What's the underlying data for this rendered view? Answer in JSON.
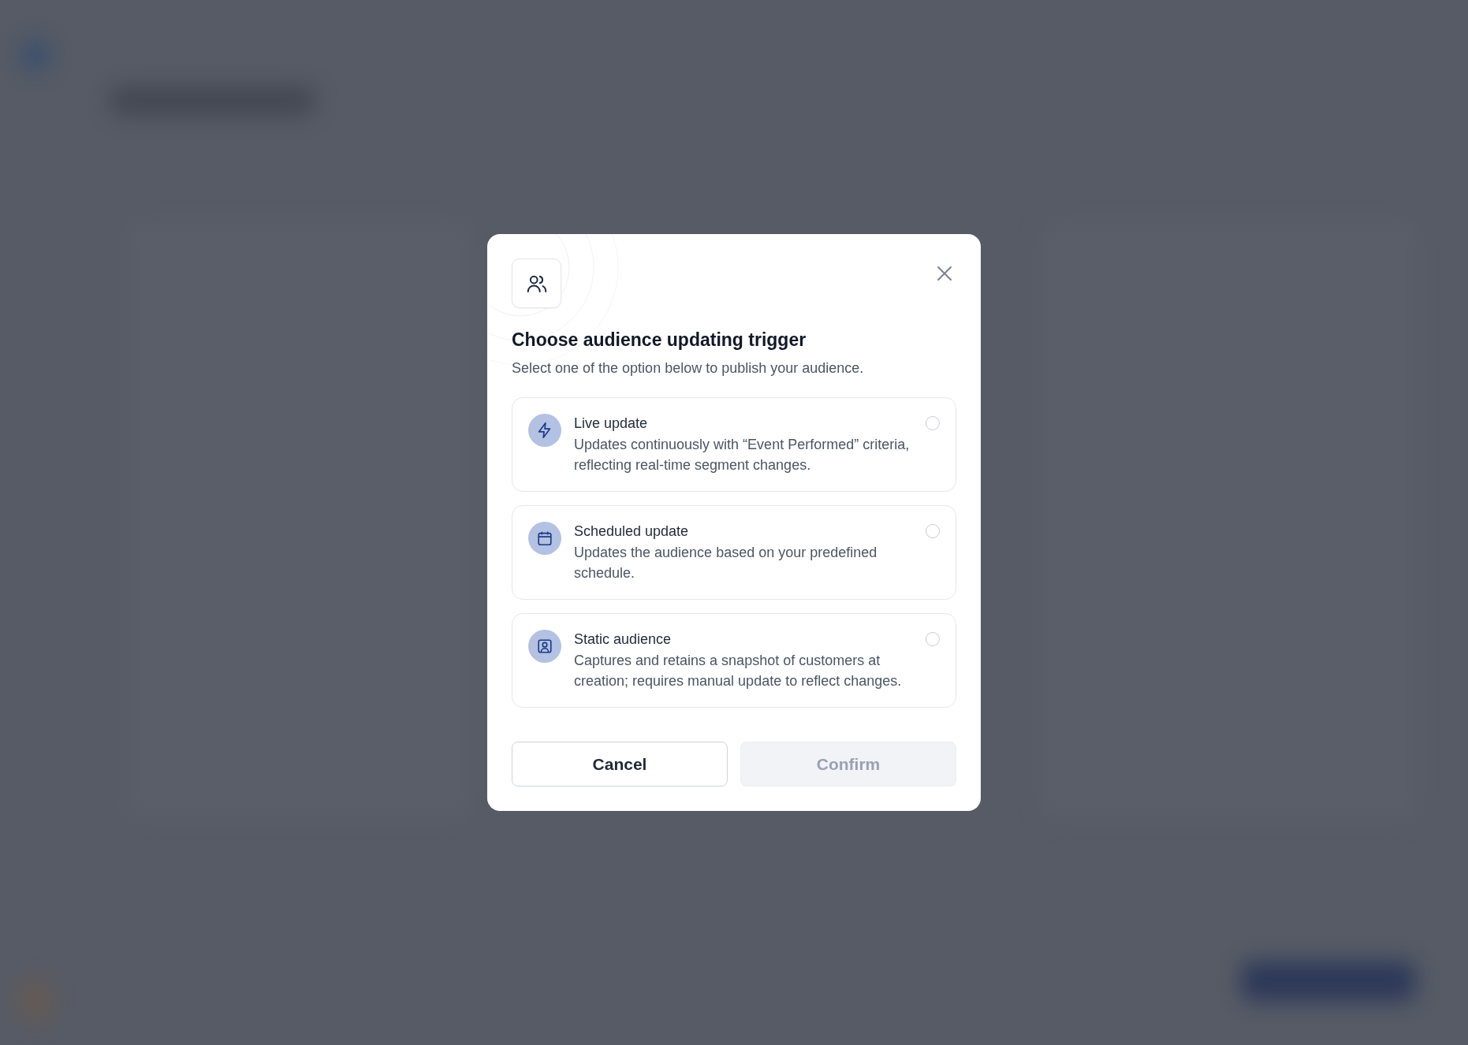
{
  "dialog": {
    "title": "Choose audience updating trigger",
    "subtitle": "Select one of the option below to publish your audience."
  },
  "options": [
    {
      "kind": "lightning",
      "title": "Live update",
      "description": "Updates continuously with “Event Performed” criteria, reflecting real-time segment changes.",
      "selected": false
    },
    {
      "kind": "calendar",
      "title": "Scheduled update",
      "description": "Updates the audience based on your predefined schedule.",
      "selected": false
    },
    {
      "kind": "person",
      "title": "Static audience",
      "description": "Captures and retains a snapshot of customers at creation; requires manual update to reflect changes.",
      "selected": false
    }
  ],
  "buttons": [
    {
      "label": "Cancel",
      "kind": "secondary",
      "disabled": false
    },
    {
      "label": "Confirm",
      "kind": "primary",
      "disabled": true
    }
  ]
}
